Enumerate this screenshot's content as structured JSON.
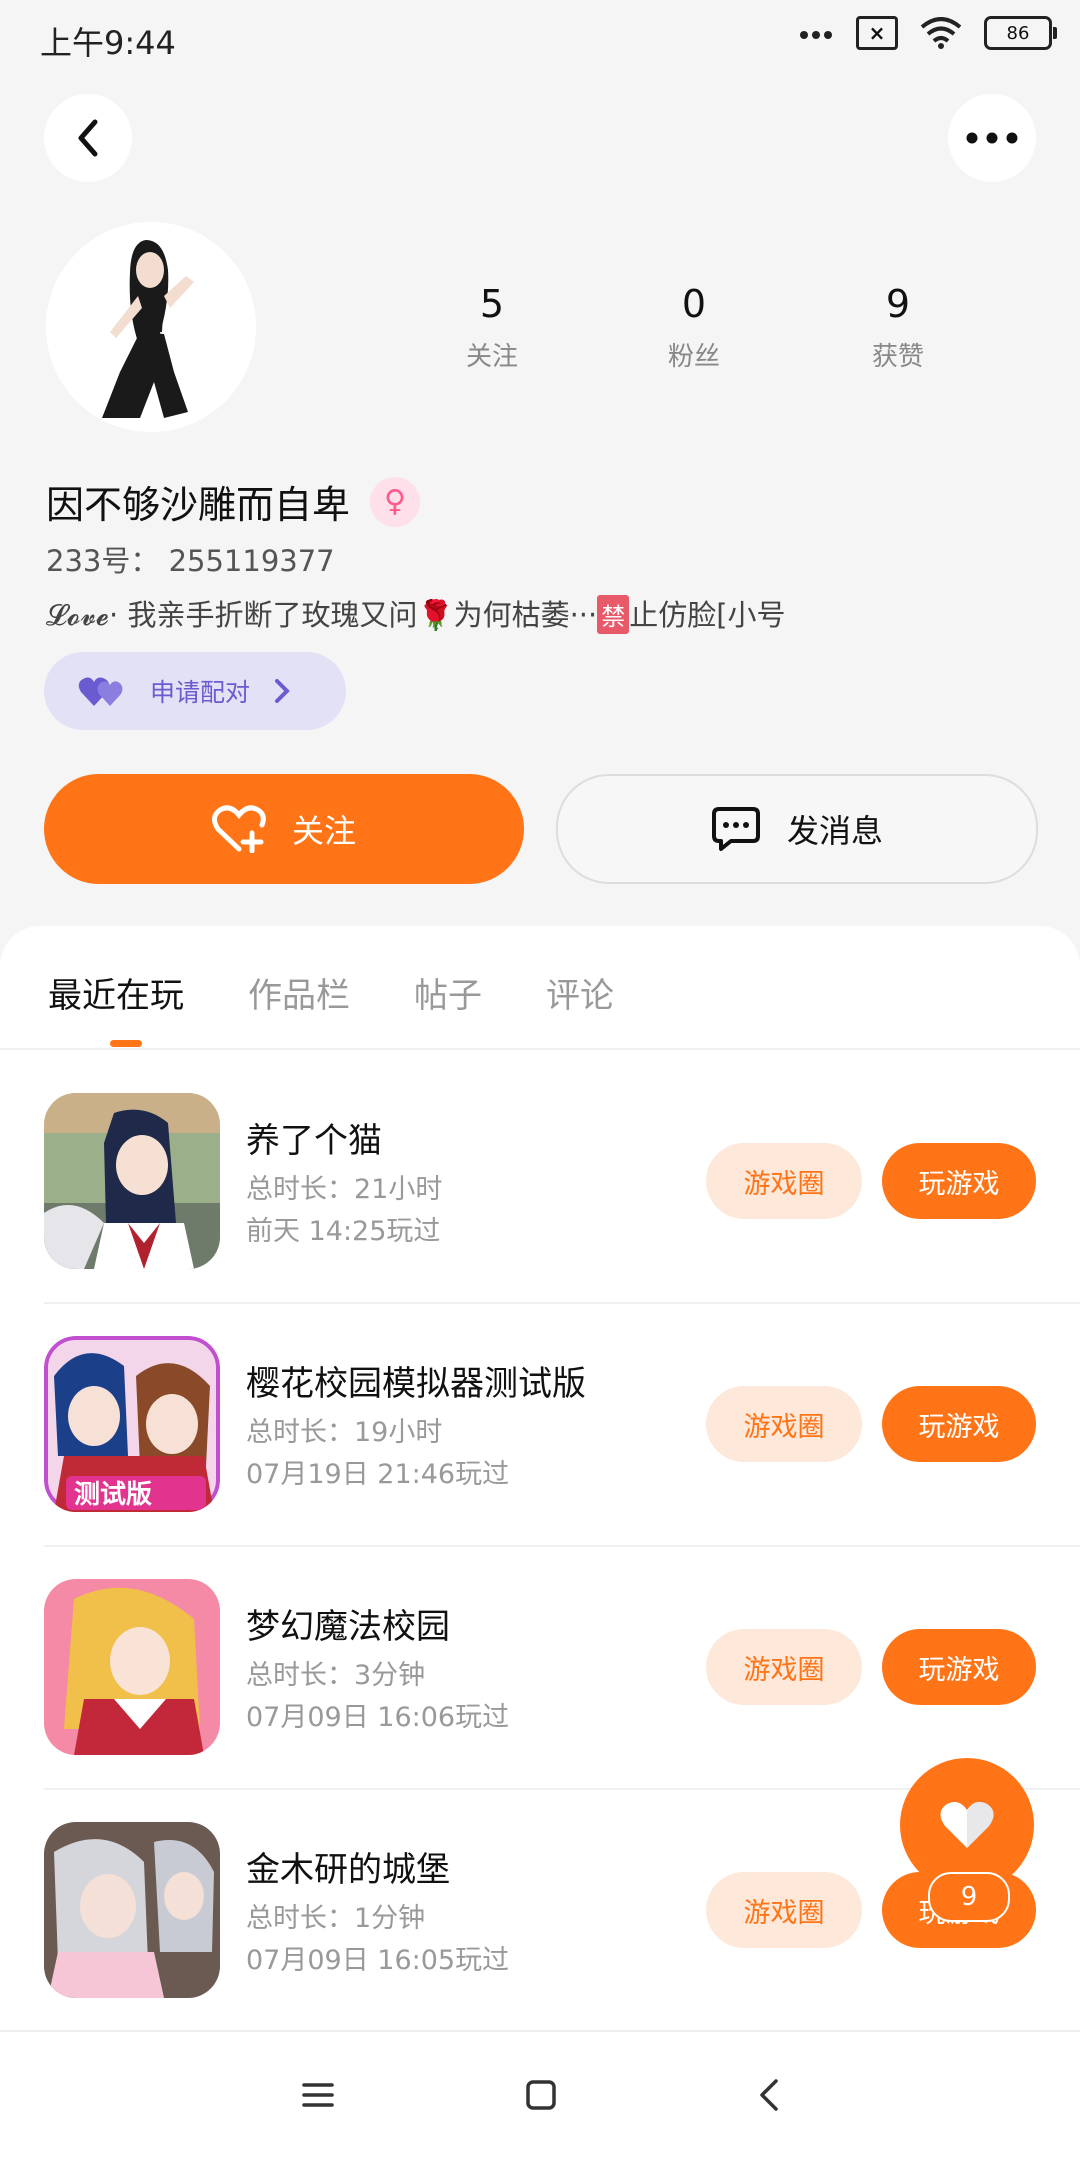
{
  "status_bar": {
    "time": "上午9:44",
    "battery": "86"
  },
  "profile": {
    "following_count": "5",
    "following_label": "关注",
    "fans_count": "0",
    "fans_label": "粉丝",
    "likes_count": "9",
    "likes_label": "获赞",
    "nickname": "因不够沙雕而自卑",
    "gender_symbol": "♀",
    "uid": "233号：  255119377",
    "bio_prefix": "𝓛𝓸𝓿𝓮· 我亲手折断了玫瑰又问🌹为何枯萎···",
    "bio_ban": "禁",
    "bio_suffix": "止仿脸[小号",
    "pair_label": "申请配对"
  },
  "actions": {
    "follow_label": "关注",
    "message_label": "发消息"
  },
  "tabs": [
    {
      "label": "最近在玩",
      "active": true
    },
    {
      "label": "作品栏",
      "active": false
    },
    {
      "label": "帖子",
      "active": false
    },
    {
      "label": "评论",
      "active": false
    }
  ],
  "games": [
    {
      "title": "养了个猫",
      "duration": "总时长：21小时",
      "last_played": "前天 14:25玩过",
      "circle_label": "游戏圈",
      "play_label": "玩游戏"
    },
    {
      "title": "樱花校园模拟器测试版",
      "duration": "总时长：19小时",
      "last_played": "07月19日 21:46玩过",
      "circle_label": "游戏圈",
      "play_label": "玩游戏",
      "icon_text": "测试版"
    },
    {
      "title": "梦幻魔法校园",
      "duration": "总时长：3分钟",
      "last_played": "07月09日 16:06玩过",
      "circle_label": "游戏圈",
      "play_label": "玩游戏"
    },
    {
      "title": "金木研的城堡",
      "duration": "总时长：1分钟",
      "last_played": "07月09日 16:05玩过",
      "circle_label": "游戏圈",
      "play_label": "玩游戏"
    }
  ],
  "fab": {
    "count": "9"
  },
  "colors": {
    "accent": "#ff7416",
    "pair_bg": "#e3e1f6",
    "pair_fg": "#6a5cd0"
  }
}
